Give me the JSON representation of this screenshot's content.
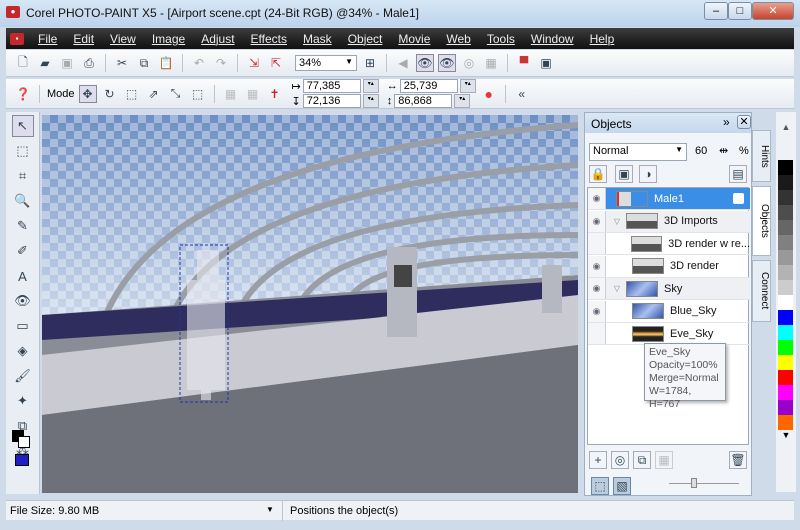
{
  "window": {
    "title": "Corel PHOTO-PAINT X5 - [Airport scene.cpt (24-Bit RGB) @34% - Male1]"
  },
  "menu": [
    "File",
    "Edit",
    "View",
    "Image",
    "Adjust",
    "Effects",
    "Mask",
    "Object",
    "Movie",
    "Web",
    "Tools",
    "Window",
    "Help"
  ],
  "toolbar": {
    "zoom": "34%"
  },
  "propbar": {
    "mode_label": "Mode",
    "x": "77,385",
    "y": "72,136",
    "w": "25,739",
    "h": "86,868"
  },
  "objects": {
    "title": "Objects",
    "merge_mode": "Normal",
    "opacity": "60",
    "opacity_unit": "%",
    "layers": [
      {
        "name": "Male1",
        "visible": true,
        "selected": true,
        "indent": 0
      },
      {
        "name": "3D Imports",
        "visible": true,
        "group": true,
        "indent": 0
      },
      {
        "name": "3D render w re...",
        "visible": false,
        "indent": 1
      },
      {
        "name": "3D render",
        "visible": true,
        "indent": 1
      },
      {
        "name": "Sky",
        "visible": true,
        "group": true,
        "indent": 0
      },
      {
        "name": "Blue_Sky",
        "visible": true,
        "indent": 1
      },
      {
        "name": "Eve_Sky",
        "visible": false,
        "indent": 1
      }
    ],
    "tooltip": [
      "Eve_Sky",
      "Opacity=100%",
      "Merge=Normal",
      "W=1784, H=767"
    ]
  },
  "tabs": {
    "hints": "Hints",
    "objects": "Objects",
    "connect": "Connect"
  },
  "palette": [
    "#000000",
    "#1a1a1a",
    "#333333",
    "#4d4d4d",
    "#666666",
    "#808080",
    "#999999",
    "#b3b3b3",
    "#cccccc",
    "#ffffff",
    "#0000ff",
    "#00ffff",
    "#00ff00",
    "#ffff00",
    "#ff0000",
    "#ff00ff",
    "#9900cc",
    "#ff6600"
  ],
  "status": {
    "file_size": "File Size: 9.80 MB",
    "message": "Positions the object(s)"
  }
}
